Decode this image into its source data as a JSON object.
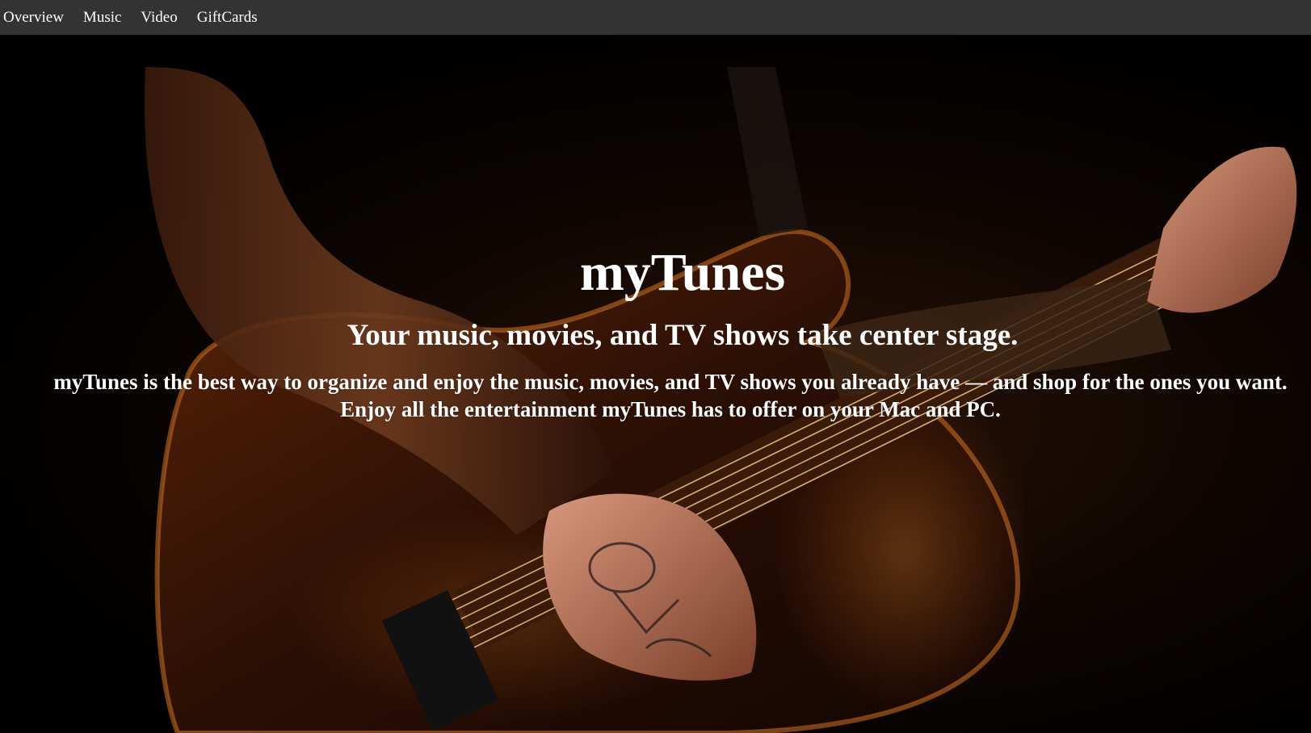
{
  "nav": {
    "items": [
      {
        "label": "Overview"
      },
      {
        "label": "Music"
      },
      {
        "label": "Video"
      },
      {
        "label": "GiftCards"
      }
    ],
    "background": "#333333",
    "text_color": "#ffffff"
  },
  "hero": {
    "title": "myTunes",
    "subtitle": "Your music, movies, and TV shows take center stage.",
    "description": "myTunes is the best way to organize and enjoy the music, movies, and TV shows you already have — and shop for the ones you want. Enjoy all the entertainment myTunes has to offer on your Mac and PC.",
    "background_image": "guitarist-playing-electric-guitar-photo",
    "text_color": "#ffffff"
  }
}
